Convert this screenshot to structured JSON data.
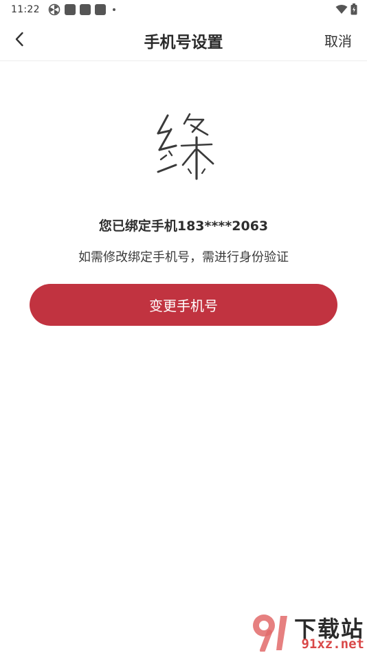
{
  "status_bar": {
    "time": "11:22",
    "left_icons": [
      "pinwheel-icon",
      "app-square-icon",
      "app-square-icon",
      "app-square-icon",
      "dot-icon"
    ],
    "right_icons": [
      "wifi-icon",
      "battery-icon"
    ]
  },
  "nav": {
    "back_icon": "chevron-left-icon",
    "title": "手机号设置",
    "cancel_label": "取消"
  },
  "main": {
    "logo_char": "絛",
    "bound_text": "您已绑定手机183****2063",
    "hint_text": "如需修改绑定手机号，需进行身份验证",
    "change_button_label": "变更手机号",
    "accent_color": "#c13340"
  },
  "watermark": {
    "top": "下载站",
    "bottom": "91xz.net"
  }
}
